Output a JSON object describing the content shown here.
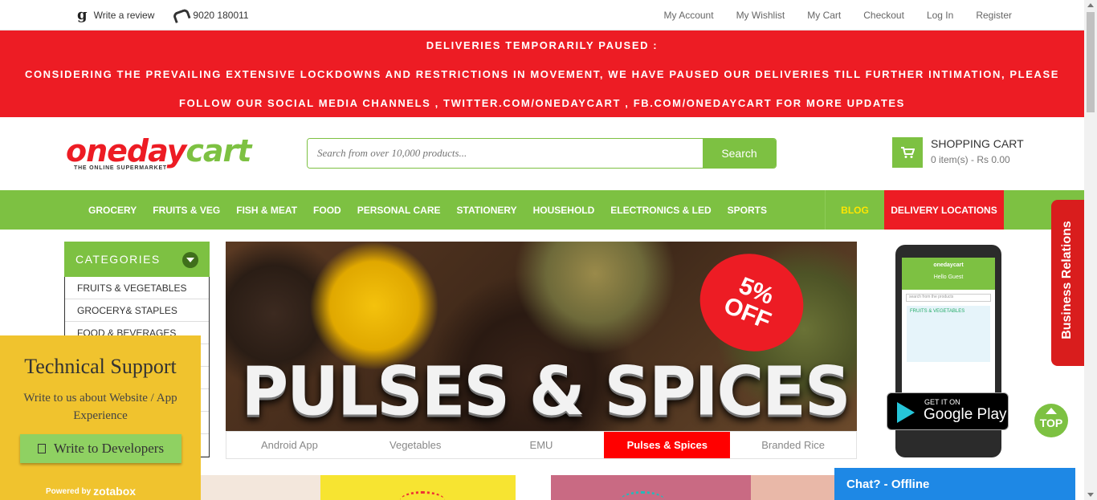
{
  "topbar": {
    "review": "Write a review",
    "phone": "9020 180011",
    "links": [
      "My Account",
      "My Wishlist",
      "My Cart",
      "Checkout",
      "Log In",
      "Register"
    ]
  },
  "notice": {
    "line1": "DELIVERIES TEMPORARILY PAUSED :",
    "line2": "CONSIDERING THE PREVAILING EXTENSIVE LOCKDOWNS AND RESTRICTIONS IN MOVEMENT, WE HAVE PAUSED OUR DELIVERIES TILL FURTHER INTIMATION, PLEASE",
    "line3": "FOLLOW OUR SOCIAL MEDIA CHANNELS , TWITTER.COM/ONEDAYCART , FB.COM/ONEDAYCART FOR MORE UPDATES"
  },
  "logo": {
    "part1": "oneday",
    "part2": "cart",
    "tagline": "THE ONLINE SUPERMARKET"
  },
  "search": {
    "placeholder": "Search from over 10,000 products...",
    "button": "Search"
  },
  "cart": {
    "title": "SHOPPING CART",
    "summary": "0 item(s) - Rs 0.00",
    "icon": "cart-icon"
  },
  "nav": {
    "items": [
      "GROCERY",
      "FRUITS & VEG",
      "FISH & MEAT",
      "FOOD",
      "PERSONAL CARE",
      "STATIONERY",
      "HOUSEHOLD",
      "ELECTRONICS & LED",
      "SPORTS"
    ],
    "blog": "BLOG",
    "delivery": "DELIVERY LOCATIONS"
  },
  "categories": {
    "title": "CATEGORIES",
    "items": [
      "FRUITS & VEGETABLES",
      "GROCERY& STAPLES",
      "FOOD & BEVERAGES",
      "",
      "",
      "",
      "",
      ""
    ]
  },
  "banner": {
    "badge_line1": "5%",
    "badge_line2": "OFF",
    "title": "PULSES & SPICES",
    "tabs": [
      "Android App",
      "Vegetables",
      "EMU",
      "Pulses & Spices",
      "Branded Rice"
    ],
    "active_tab": 3
  },
  "app": {
    "phone_brand": "onedaycart",
    "phone_greeting": "Hello Guest",
    "phone_search": "search from the products",
    "phone_promo": "FRUITS & VEGETABLES",
    "store_small": "GET IT ON",
    "store_big": "Google Play"
  },
  "top_button": "TOP",
  "business": "Business Relations",
  "tech": {
    "title": "Technical Support",
    "desc": "Write to us about Website / App Experience",
    "button": "Write to Developers",
    "powered": "Powered by",
    "brand": "zotabox"
  },
  "chat": "Chat? - Offline",
  "colors": {
    "green": "#7dc142",
    "red": "#ed1c24",
    "yellow": "#f0c32e",
    "blue": "#1e88e5"
  }
}
